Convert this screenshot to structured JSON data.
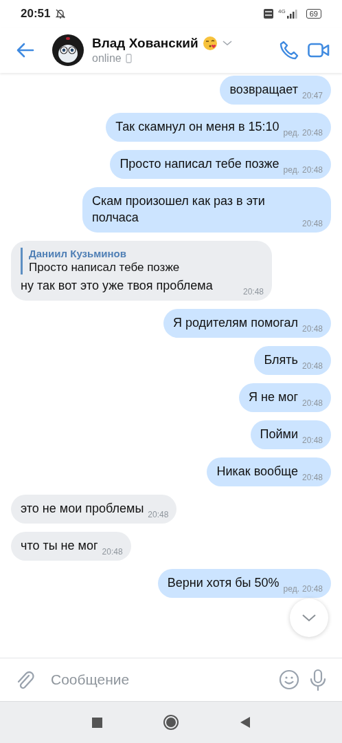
{
  "status_bar": {
    "time": "20:51",
    "network": "4G",
    "battery": "69"
  },
  "header": {
    "name": "Влад Хованский",
    "status": "online"
  },
  "messages": [
    {
      "kind": "out",
      "text": "возвращает",
      "time": "20:47"
    },
    {
      "kind": "out",
      "text": "Так скамнул он меня в 15:10",
      "time": "20:48",
      "edited": "ред."
    },
    {
      "kind": "out",
      "text": "Просто написал тебе позже",
      "time": "20:48",
      "edited": "ред."
    },
    {
      "kind": "out",
      "text": "Скам произошел как раз в эти полчаса",
      "time": "20:48"
    },
    {
      "kind": "in",
      "text": "ну так вот это уже твоя проблема",
      "time": "20:48",
      "reply": {
        "author": "Даниил Кузьминов",
        "text": "Просто написал тебе позже"
      }
    },
    {
      "kind": "out",
      "text": "Я родителям помогал",
      "time": "20:48"
    },
    {
      "kind": "out",
      "text": "Блять",
      "time": "20:48"
    },
    {
      "kind": "out",
      "text": "Я не мог",
      "time": "20:48"
    },
    {
      "kind": "out",
      "text": "Пойми",
      "time": "20:48"
    },
    {
      "kind": "out",
      "text": "Никак вообще",
      "time": "20:48"
    },
    {
      "kind": "in",
      "text": "это не мои проблемы",
      "time": "20:48"
    },
    {
      "kind": "in",
      "text": "что ты не мог",
      "time": "20:48"
    },
    {
      "kind": "out",
      "text": "Верни хотя бы 50%",
      "time": "20:48",
      "edited": "ред."
    }
  ],
  "composer": {
    "placeholder": "Сообщение"
  }
}
